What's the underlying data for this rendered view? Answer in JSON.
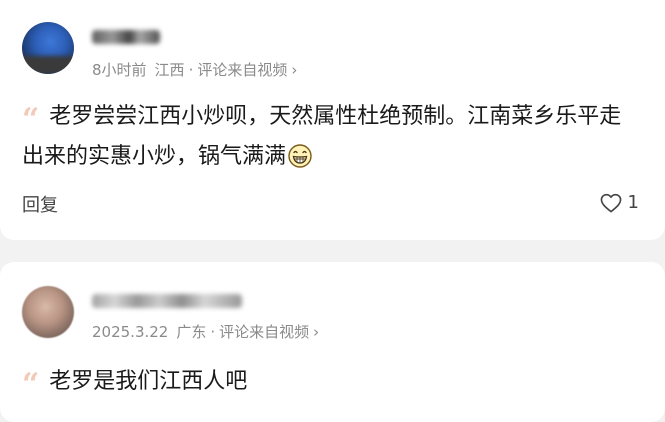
{
  "comments": [
    {
      "time": "8小时前",
      "location": "江西",
      "source": "评论来自视频",
      "text": "老罗尝尝江西小炒呗，天然属性杜绝预制。江南菜乡乐平走出来的实惠小炒，锅气满满",
      "emoji": "grinning-face-icon",
      "reply_label": "回复",
      "likes": "1"
    },
    {
      "time": "2025.3.22",
      "location": "广东",
      "source": "评论来自视频",
      "text": "老罗是我们江西人吧"
    }
  ],
  "ui": {
    "separator": "·",
    "chevron": "›",
    "quote_glyph": "“"
  },
  "colors": {
    "meta_text": "#8a8a8a",
    "quote_mark": "#f3c9b7",
    "card_bg": "#ffffff",
    "page_bg": "#f2f2f2"
  }
}
